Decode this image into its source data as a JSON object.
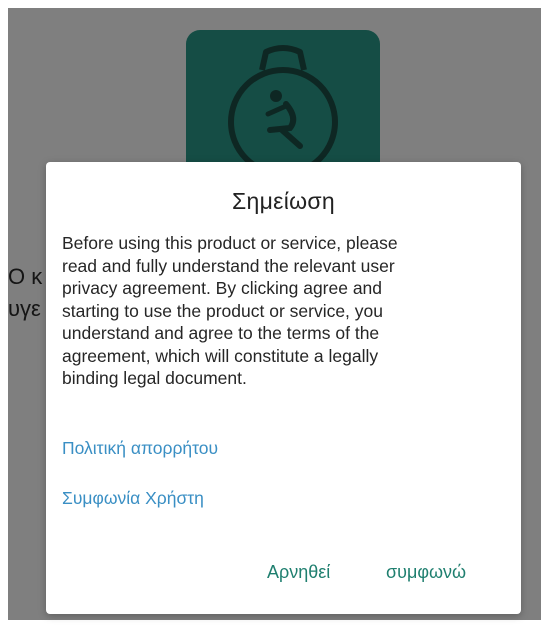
{
  "background": {
    "logo_icon": "runner-watch-icon",
    "text_line1": "Ο κ",
    "text_line2": "υγε"
  },
  "dialog": {
    "title": "Σημείωση",
    "message": [
      "Before using this product or service, please",
      "read and fully understand the relevant user",
      "privacy agreement. By clicking agree and",
      "starting to use the product or service, you",
      "understand and agree to the terms of the",
      "agreement, which will constitute a legally",
      "binding legal document."
    ],
    "links": {
      "privacy_policy": "Πολιτική απορρήτου",
      "user_agreement": "Συμφωνία Χρήστη"
    },
    "buttons": {
      "deny": "Αρνηθεί",
      "agree": "συμφωνώ"
    }
  },
  "colors": {
    "logo_bg": "#2a9a8a",
    "link": "#3a8fc4",
    "action": "#1f7f6f"
  }
}
